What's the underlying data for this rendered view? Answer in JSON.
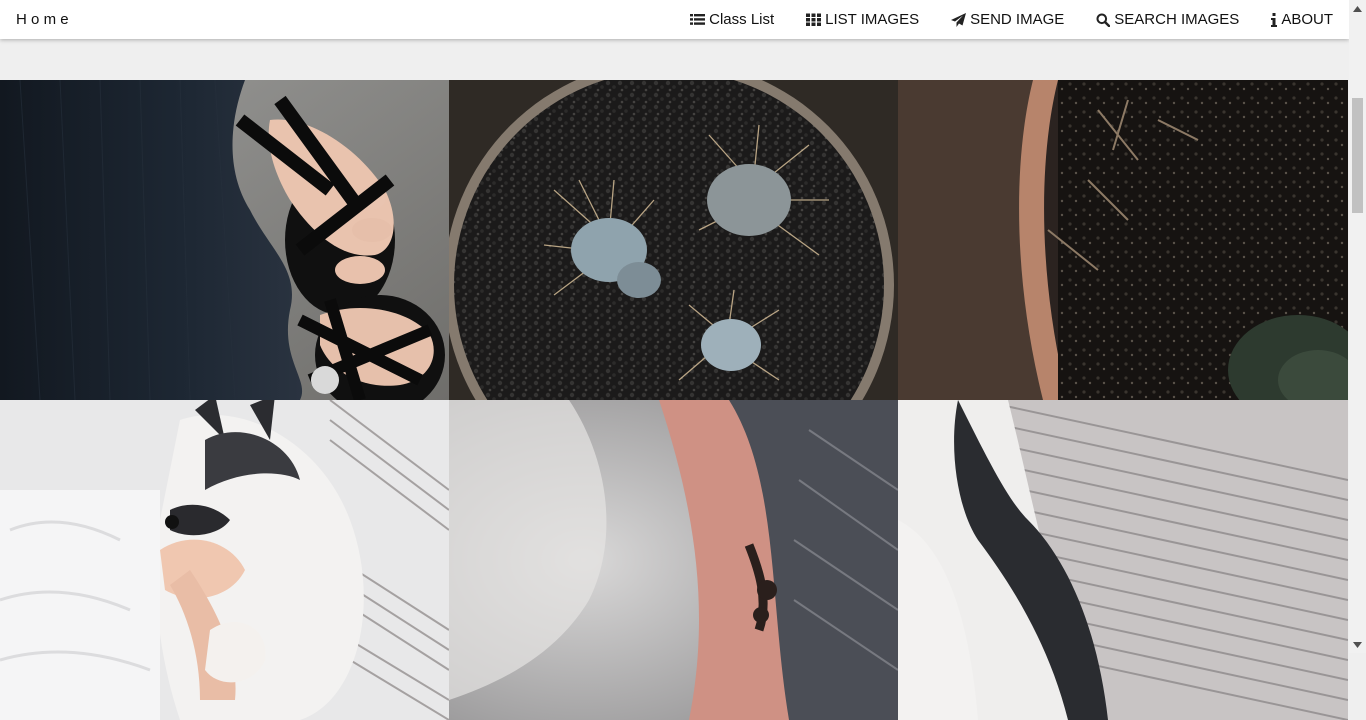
{
  "navbar": {
    "brand": "Home",
    "items": [
      {
        "label": "Class List",
        "icon": "list-icon"
      },
      {
        "label": "LIST IMAGES",
        "icon": "grid-icon"
      },
      {
        "label": "SEND IMAGE",
        "icon": "paper-plane-icon"
      },
      {
        "label": "SEARCH IMAGES",
        "icon": "search-icon"
      },
      {
        "label": "ABOUT",
        "icon": "info-icon"
      }
    ]
  },
  "gallery": {
    "images": [
      {
        "subject": "feet-in-sandals-photo"
      },
      {
        "subject": "cactus-in-pot-photo"
      },
      {
        "subject": "potted-soil-photo"
      },
      {
        "subject": "sleeping-husky-puppy-photo"
      },
      {
        "subject": "puppy-fur-and-tattooed-hand-photo"
      },
      {
        "subject": "puppy-fur-on-striped-bedding-photo"
      }
    ]
  },
  "colors": {
    "navbar_bg": "#ffffff",
    "page_bg": "#efefef"
  }
}
